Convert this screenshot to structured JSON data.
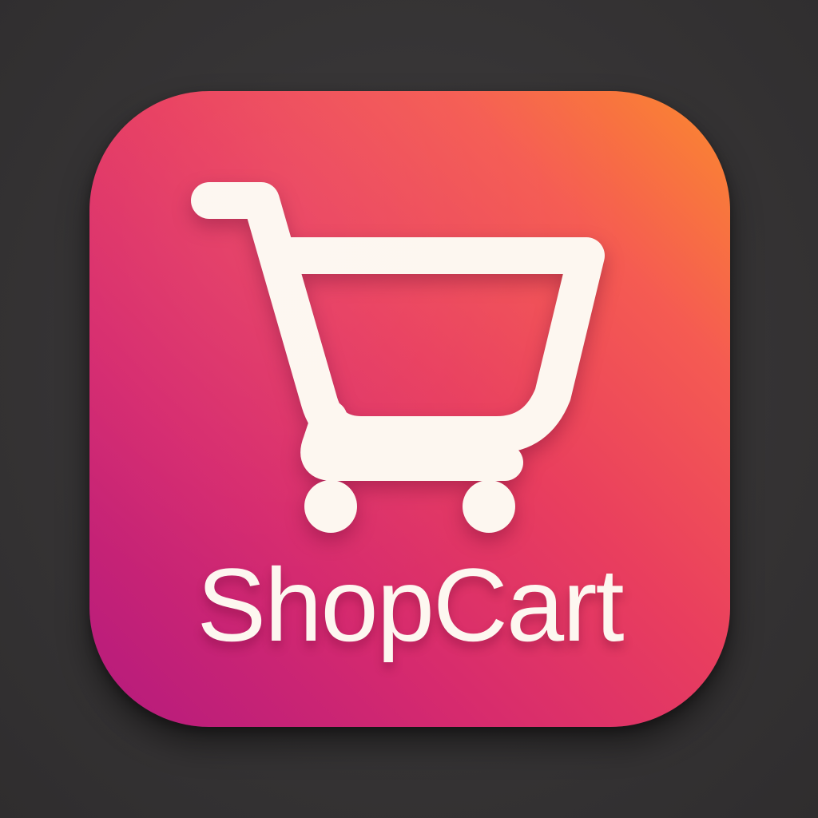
{
  "app": {
    "name": "ShopCart",
    "icon": "shopping-cart-icon"
  },
  "colors": {
    "background": "#3a3839",
    "gradient_top_right": "#fb8a2e",
    "gradient_middle": "#e93e5e",
    "gradient_bottom_left": "#b41a7e",
    "glyph": "#fdf7f0"
  }
}
